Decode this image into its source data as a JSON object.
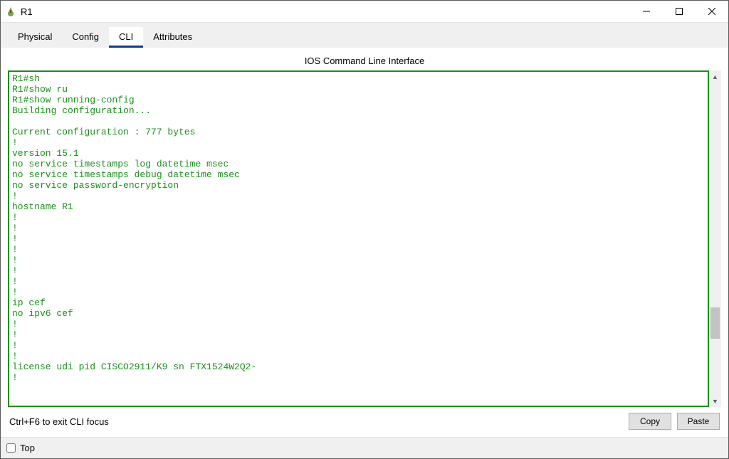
{
  "window": {
    "title": "R1"
  },
  "tabs": {
    "items": [
      "Physical",
      "Config",
      "CLI",
      "Attributes"
    ],
    "active_index": 2
  },
  "cli": {
    "panel_title": "IOS Command Line Interface",
    "output": "R1#sh\nR1#show ru\nR1#show running-config \nBuilding configuration...\n\nCurrent configuration : 777 bytes\n!\nversion 15.1\nno service timestamps log datetime msec\nno service timestamps debug datetime msec\nno service password-encryption\n!\nhostname R1\n!\n!\n!\n!\n!\n!\n!\n!\nip cef\nno ipv6 cef\n!\n!\n!\n!\nlicense udi pid CISCO2911/K9 sn FTX1524W2Q2-\n!"
  },
  "footer": {
    "hint": "Ctrl+F6 to exit CLI focus",
    "copy_label": "Copy",
    "paste_label": "Paste"
  },
  "statusbar": {
    "top_checkbox_label": "Top",
    "top_checked": false
  }
}
